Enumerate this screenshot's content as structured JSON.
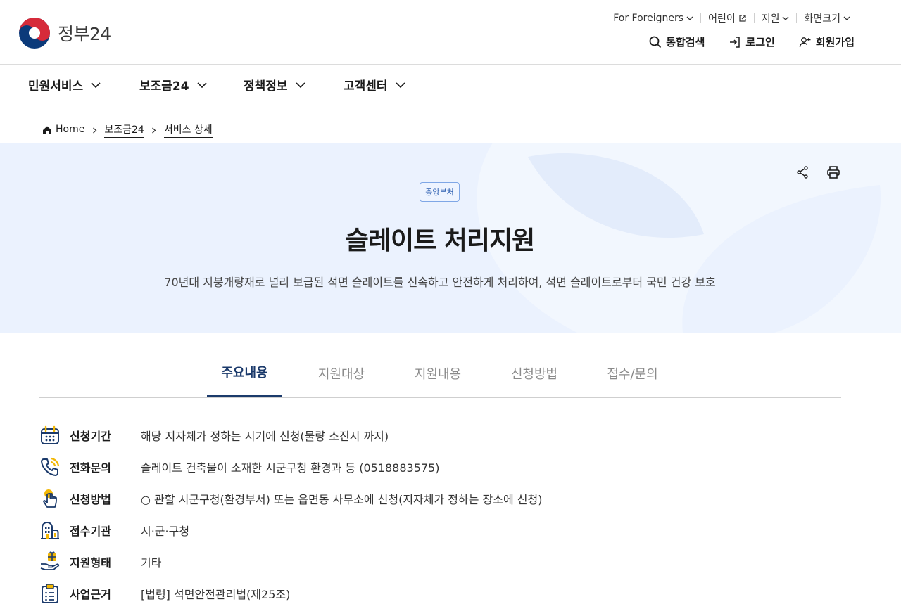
{
  "brand": {
    "name": "정부24"
  },
  "utility": [
    {
      "label": "For Foreigners",
      "icon": "chevron-down-icon"
    },
    {
      "label": "어린이",
      "icon": "external-link-icon"
    },
    {
      "label": "지원",
      "icon": "chevron-down-icon"
    },
    {
      "label": "화면크기",
      "icon": "chevron-down-icon"
    }
  ],
  "actions": {
    "search": "통합검색",
    "login": "로그인",
    "signup": "회원가입"
  },
  "gnb": [
    "민원서비스",
    "보조금24",
    "정책정보",
    "고객센터"
  ],
  "breadcrumb": [
    "Home",
    "보조금24",
    "서비스 상세"
  ],
  "hero": {
    "badge": "중앙부처",
    "title": "슬레이트 처리지원",
    "description": "70년대 지붕개량재로 널리 보급된 석면 슬레이트를 신속하고 안전하게 처리하여, 석면 슬레이트로부터 국민 건강 보호"
  },
  "tabs": [
    "주요내용",
    "지원대상",
    "지원내용",
    "신청방법",
    "접수/문의"
  ],
  "info": [
    {
      "label": "신청기간",
      "value": "해당 지자체가 정하는 시기에 신청(물량 소진시 까지)",
      "icon": "calendar-icon"
    },
    {
      "label": "전화문의",
      "value": "슬레이트 건축물이 소재한 시군구청 환경과 등 (0518883575)",
      "icon": "phone-icon"
    },
    {
      "label": "신청방법",
      "value": "○ 관할 시군구청(환경부서) 또는 읍면동 사무소에 신청(지자체가 정하는 장소에 신청)",
      "icon": "touch-hand-icon"
    },
    {
      "label": "접수기관",
      "value": "시·군·구청",
      "icon": "building-icon"
    },
    {
      "label": "지원형태",
      "value": "기타",
      "icon": "gift-hand-icon"
    },
    {
      "label": "사업근거",
      "value": "[법령] 석면안전관리법(제25조)",
      "icon": "clipboard-icon"
    }
  ],
  "colors": {
    "accent": "#1b3a6b",
    "hero_bg": "#ebf2fe",
    "badge_border": "#7fa7e6"
  }
}
